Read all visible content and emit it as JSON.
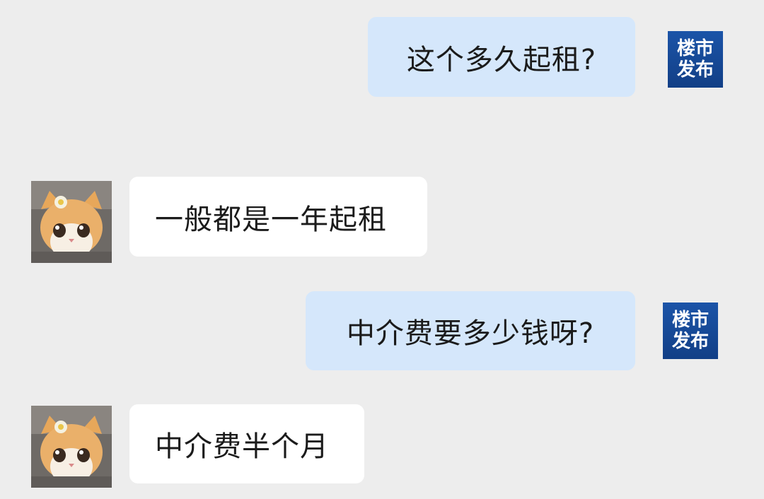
{
  "conversation": {
    "messages": [
      {
        "side": "sent",
        "text": "这个多久起租?",
        "avatar_logo": "楼市发布"
      },
      {
        "side": "received",
        "text": "一般都是一年起租",
        "avatar_icon": "cat-avatar-icon"
      },
      {
        "side": "sent",
        "text": "中介费要多少钱呀?",
        "avatar_logo": "楼市发布"
      },
      {
        "side": "received",
        "text": "中介费半个月",
        "avatar_icon": "cat-avatar-icon"
      }
    ]
  },
  "colors": {
    "background": "#ededed",
    "sent_bubble": "#d5e7fb",
    "received_bubble": "#ffffff",
    "logo_blue": "#1b54a8"
  }
}
